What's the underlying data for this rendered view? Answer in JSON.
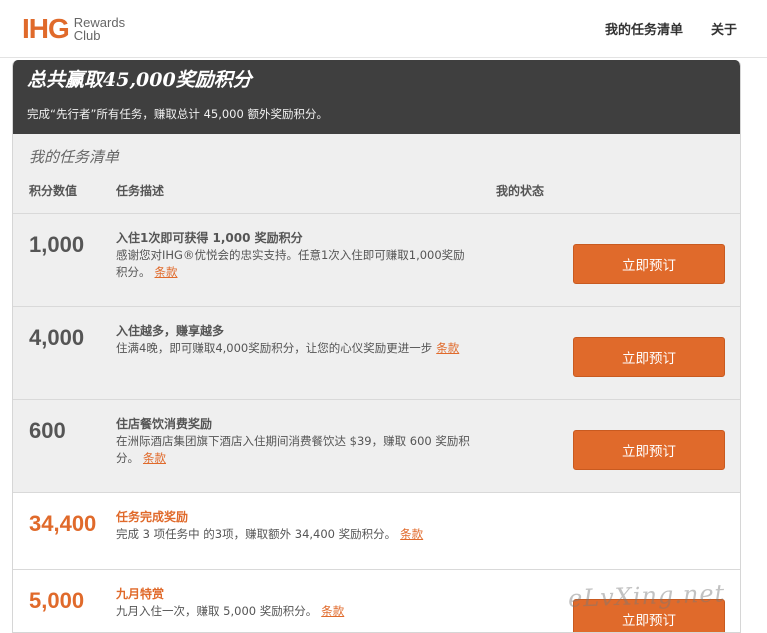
{
  "header": {
    "logo_mark": "IHG",
    "logo_text_1": "Rewards",
    "logo_text_2": "Club",
    "nav": [
      "我的任务清单",
      "关于"
    ]
  },
  "banner": {
    "title": "总共赢取45,000奖励积分",
    "subtitle": "完成“先行者”所有任务，赚取总计 45,000 额外奖励积分。"
  },
  "list": {
    "title": "我的任务清单",
    "columns": [
      "积分数值",
      "任务描述",
      "我的状态"
    ]
  },
  "tasks": [
    {
      "points": "1,000",
      "title": "入住1次即可获得 1,000 奖励积分",
      "desc": "感谢您对IHG®优悦会的忠实支持。任意1次入住即可赚取1,000奖励积分。",
      "terms": "条款",
      "button": "立即预订"
    },
    {
      "points": "4,000",
      "title": "入住越多，赚享越多",
      "desc": "住满4晚，即可赚取4,000奖励积分，让您的心仪奖励更进一步",
      "terms": "条款",
      "button": "立即预订"
    },
    {
      "points": "600",
      "title": "住店餐饮消费奖励",
      "desc": "在洲际酒店集团旗下酒店入住期间消费餐饮达 $39，赚取 600 奖励积分。",
      "terms": "条款",
      "button": "立即预订"
    },
    {
      "points": "34,400",
      "title": "任务完成奖励",
      "desc": "完成 3 项任务中 的3项，赚取额外 34,400 奖励积分。",
      "terms": "条款"
    },
    {
      "points": "5,000",
      "title": "九月特赏",
      "desc": "九月入住一次，赚取 5,000 奖励积分。",
      "terms": "条款",
      "button": "立即预订"
    }
  ],
  "watermark": "eLvXing.net",
  "colors": {
    "accent": "#e06a2b",
    "banner_bg": "#3f3f3f",
    "row_bg": "#efefef"
  }
}
